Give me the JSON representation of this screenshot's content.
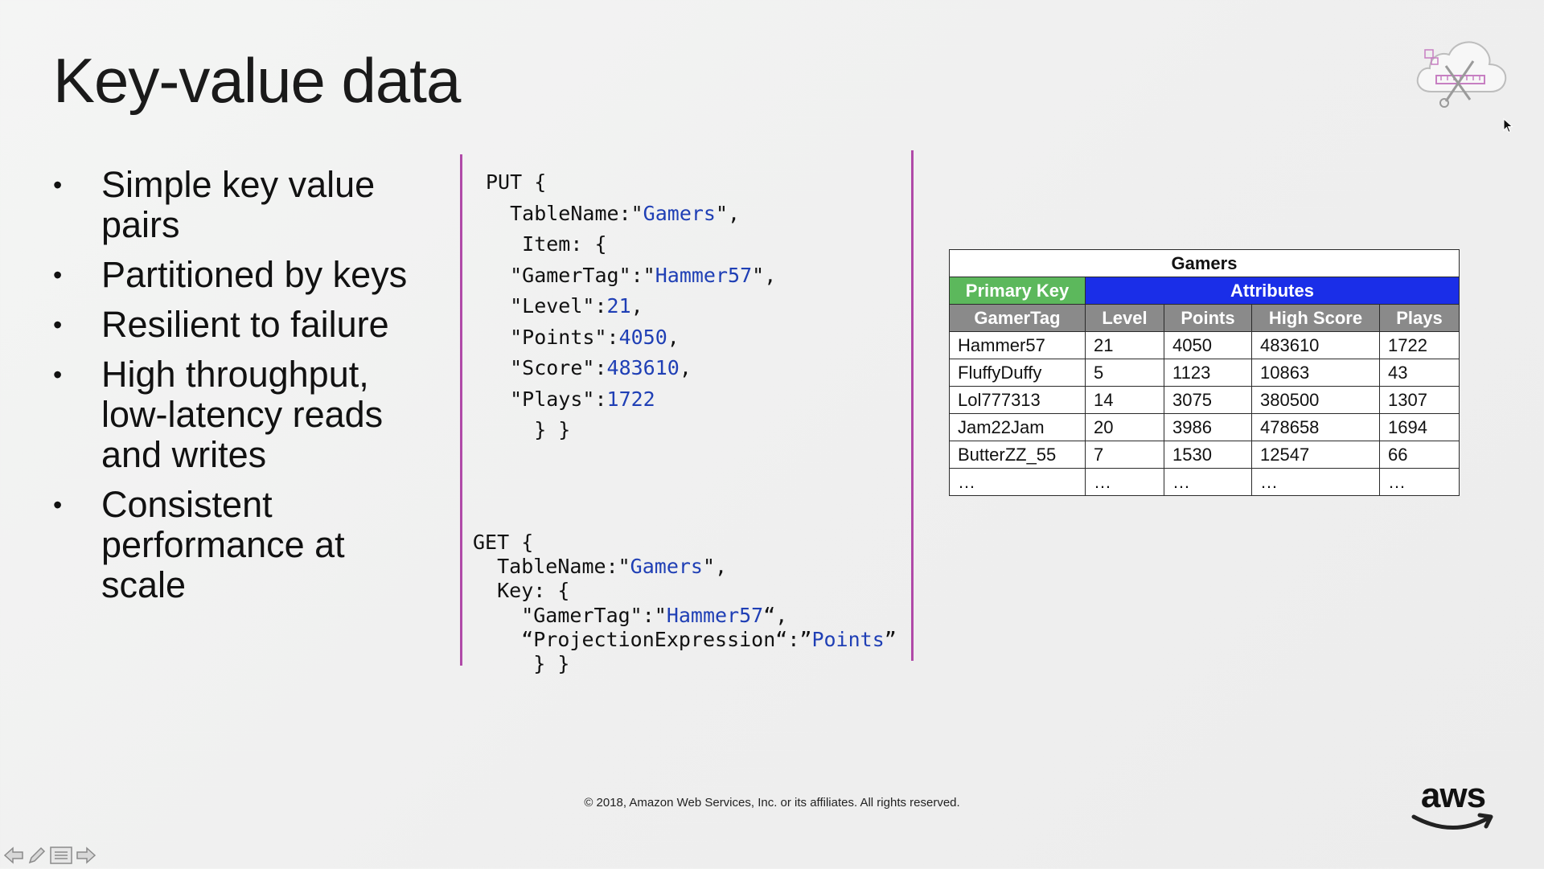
{
  "slide": {
    "title": "Key-value data",
    "bullets": [
      "Simple key value pairs",
      "Partitioned by keys",
      "Resilient to failure",
      "High throughput, low-latency reads and writes",
      "Consistent performance at scale"
    ]
  },
  "put_code": {
    "lines": [
      [
        "PUT {"
      ],
      [
        "  TableName:\"",
        {
          "v": "Gamers"
        },
        "\","
      ],
      [
        "   Item: {"
      ],
      [
        "  \"GamerTag\":\"",
        {
          "v": "Hammer57"
        },
        "\","
      ],
      [
        "  \"Level\":",
        {
          "v": "21"
        },
        ","
      ],
      [
        "  \"Points\":",
        {
          "v": "4050"
        },
        ","
      ],
      [
        "  \"Score\":",
        {
          "v": "483610"
        },
        ","
      ],
      [
        "  \"Plays\":",
        {
          "v": "1722"
        }
      ],
      [
        "    } }"
      ]
    ]
  },
  "get_code": {
    "lines": [
      [
        "GET {"
      ],
      [
        "  TableName:\"",
        {
          "v": "Gamers"
        },
        "\","
      ],
      [
        "  Key: {"
      ],
      [
        "    \"GamerTag\":\"",
        {
          "v": "Hammer57"
        },
        "“,"
      ],
      [
        "    “ProjectionExpression“:”",
        {
          "v": "Points"
        },
        "”"
      ],
      [
        "     } }"
      ]
    ]
  },
  "table": {
    "caption": "Gamers",
    "primary_key_label": "Primary Key",
    "attributes_label": "Attributes",
    "headers": [
      "GamerTag",
      "Level",
      "Points",
      "High Score",
      "Plays"
    ],
    "rows": [
      [
        "Hammer57",
        "21",
        "4050",
        "483610",
        "1722"
      ],
      [
        "FluffyDuffy",
        "5",
        "1123",
        "10863",
        "43"
      ],
      [
        "Lol777313",
        "14",
        "3075",
        "380500",
        "1307"
      ],
      [
        "Jam22Jam",
        "20",
        "3986",
        "478658",
        "1694"
      ],
      [
        "ButterZZ_55",
        "7",
        "1530",
        "12547",
        "66"
      ],
      [
        "…",
        "…",
        "…",
        "…",
        "…"
      ]
    ],
    "colors": {
      "primary_key": "#5cb85c",
      "attributes": "#1a2ee8",
      "header": "#8a8a8a"
    }
  },
  "footer": {
    "copyright": "© 2018, Amazon Web Services, Inc. or its affiliates. All rights reserved."
  },
  "logo": {
    "text": "aws"
  },
  "icons": {
    "top_right": "cloud-tools-icon",
    "toolbar": [
      "prev-arrow-icon",
      "pen-icon",
      "menu-icon",
      "next-arrow-icon"
    ]
  },
  "colors": {
    "accent_line": "#b04aa8",
    "code_value": "#1f3fb5",
    "logo_smile": "#222222"
  }
}
